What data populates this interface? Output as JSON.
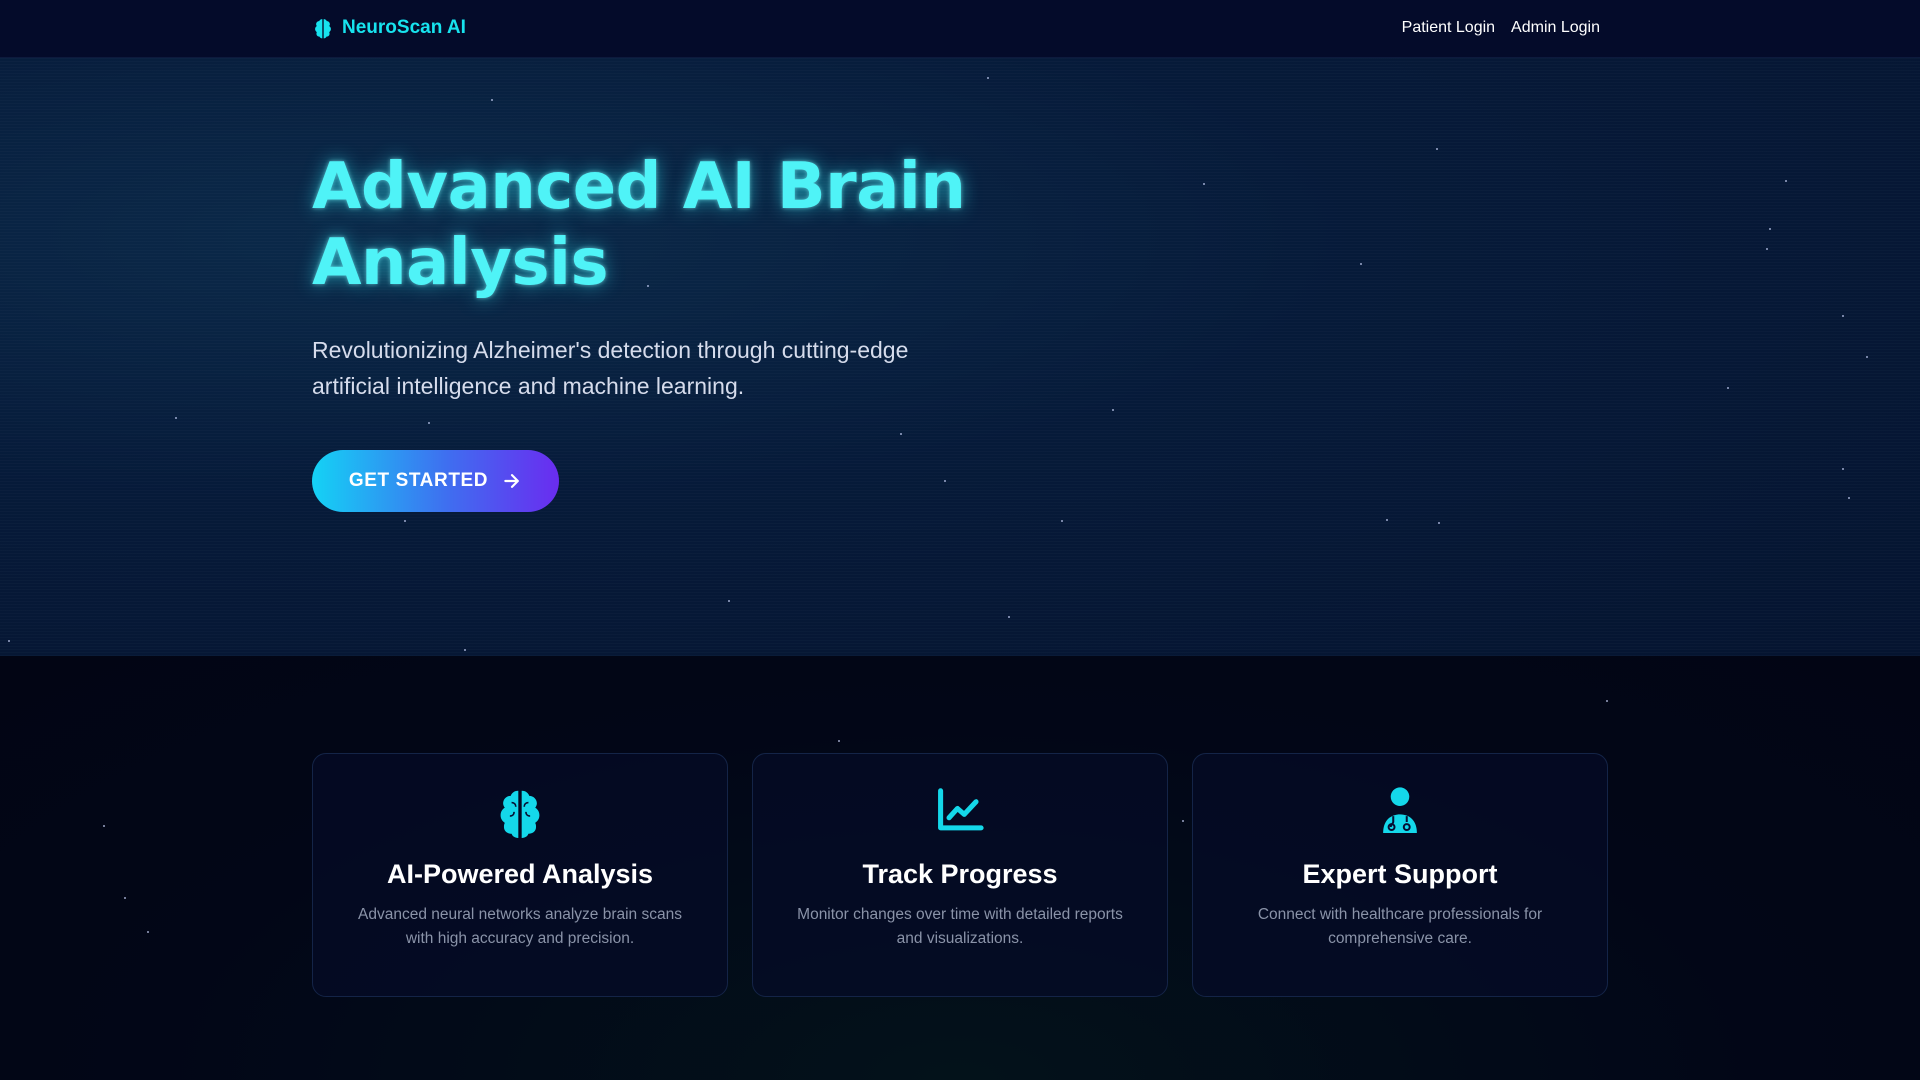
{
  "navbar": {
    "brand": "NeuroScan AI",
    "brand_icon": "brain-icon",
    "links": [
      "Patient Login",
      "Admin Login"
    ]
  },
  "hero": {
    "title": "Advanced AI Brain Analysis",
    "subtitle": "Revolutionizing Alzheimer's detection through cutting-edge artificial intelligence and machine learning.",
    "cta_label": "GET STARTED",
    "cta_icon": "arrow-right-icon"
  },
  "features": [
    {
      "icon": "brain-icon",
      "title": "AI-Powered Analysis",
      "description": "Advanced neural networks analyze brain scans with high accuracy and precision."
    },
    {
      "icon": "chart-line-icon",
      "title": "Track Progress",
      "description": "Monitor changes over time with detailed reports and visualizations."
    },
    {
      "icon": "doctor-icon",
      "title": "Expert Support",
      "description": "Connect with healthcare professionals for comprehensive care."
    }
  ],
  "colors": {
    "accent": "#17e3ee",
    "gradient_start": "#14d2f5",
    "gradient_end": "#6a2cf0",
    "background": "#030a24"
  }
}
